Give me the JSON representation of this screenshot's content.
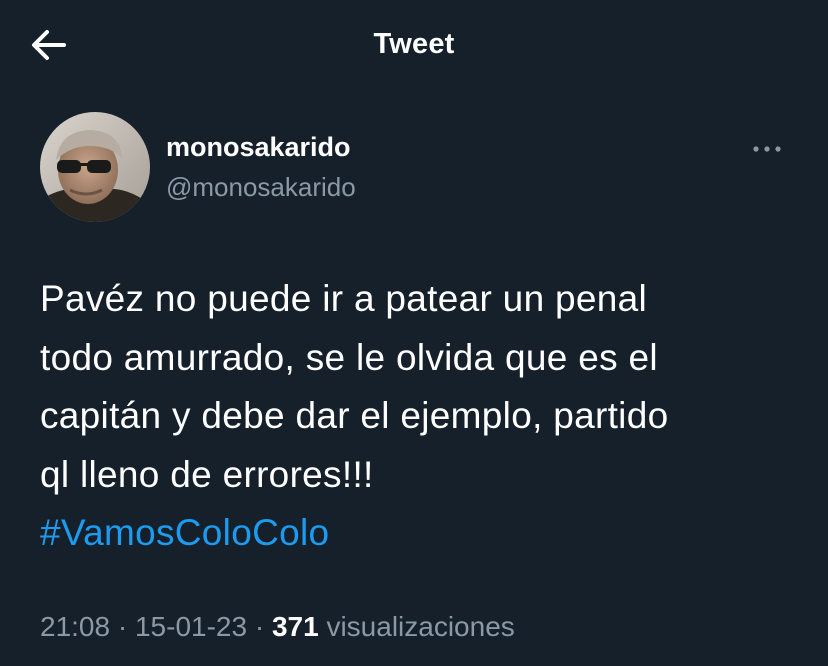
{
  "header": {
    "title": "Tweet",
    "back_icon": "arrow-left-icon"
  },
  "author": {
    "display_name": "monosakarido",
    "handle": "@monosakarido",
    "more_icon": "more-horizontal-icon"
  },
  "tweet": {
    "lines": [
      "Pavéz no puede ir a patear un penal",
      "todo amurrado, se le olvida que es el",
      "capitán y debe dar el ejemplo, partido",
      "ql lleno de errores!!!"
    ],
    "hashtag": "#VamosColoColo"
  },
  "meta": {
    "time": "21:08",
    "separator": "·",
    "date": "15-01-23",
    "views_count": "371",
    "views_label": "visualizaciones"
  },
  "colors": {
    "background": "#15202b",
    "text": "#ffffff",
    "secondary_text": "#8b98a5",
    "link": "#1d9bf0"
  }
}
